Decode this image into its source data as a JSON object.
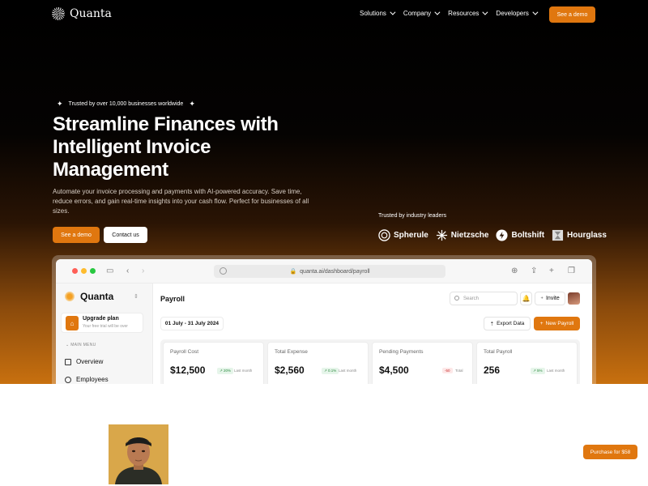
{
  "nav": {
    "brand": "Quanta",
    "links": [
      "Solutions",
      "Company",
      "Resources",
      "Developers"
    ],
    "cta": "See a demo"
  },
  "hero": {
    "badge": "Trusted by over 10,000 businesses worldwide",
    "headline": "Streamline Finances with Intelligent Invoice Management",
    "subtext": "Automate your invoice processing and payments with AI-powered accuracy. Save time, reduce errors, and gain real-time insights into your cash flow. Perfect for businesses of all sizes.",
    "primary_cta": "See a demo",
    "secondary_cta": "Contact us",
    "leaders_title": "Trusted by industry leaders",
    "leaders": [
      "Spherule",
      "Nietzsche",
      "Boltshift",
      "Hourglass"
    ]
  },
  "browser": {
    "url": "quanta.ai/dashboard/payroll"
  },
  "app": {
    "brand": "Quanta",
    "upgrade_title": "Upgrade plan",
    "upgrade_sub": "Your free trial will be over",
    "section_label": "MAIN MENU",
    "menu": [
      "Overview",
      "Employees"
    ],
    "page_title": "Payroll",
    "search_placeholder": "Search",
    "invite": "Invite",
    "date_range": "01 July - 31 July 2024",
    "export": "Export Data",
    "new_payroll": "New Payroll",
    "kpis": [
      {
        "label": "Payroll Cost",
        "value": "$12,500",
        "badge": "20%",
        "badge_dir": "up",
        "note": "Last month"
      },
      {
        "label": "Total Expense",
        "value": "$2,560",
        "badge": "0.1%",
        "badge_dir": "up",
        "note": "Last month"
      },
      {
        "label": "Pending Payments",
        "value": "$4,500",
        "badge": "-50",
        "badge_dir": "down",
        "note": "Total"
      },
      {
        "label": "Total Payroll",
        "value": "256",
        "badge": "5%",
        "badge_dir": "up",
        "note": "Last month"
      }
    ]
  },
  "purchase_button": "Purchase for $58",
  "colors": {
    "accent": "#e0770f"
  }
}
